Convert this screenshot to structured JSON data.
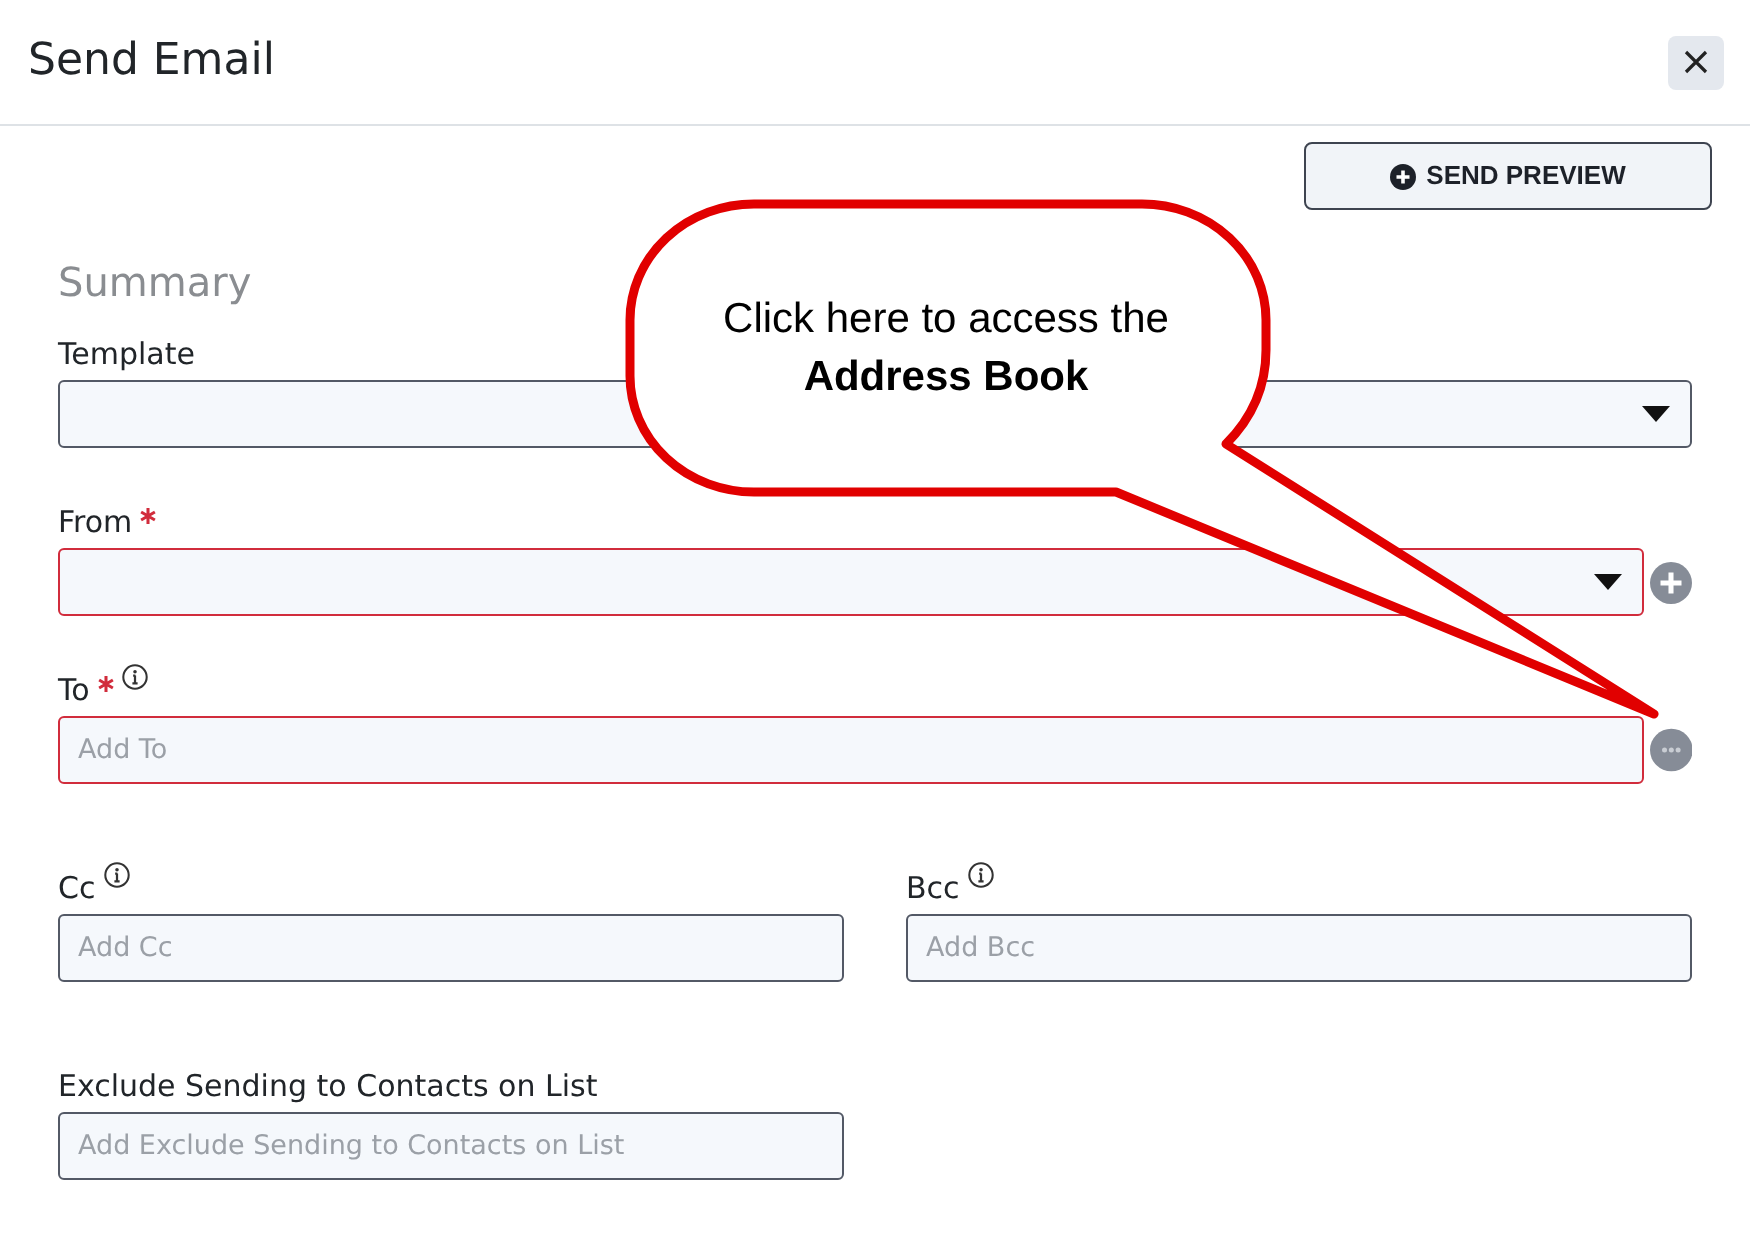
{
  "dialog": {
    "title": "Send Email"
  },
  "toolbar": {
    "send_preview": "SEND PREVIEW"
  },
  "section": {
    "title": "Summary"
  },
  "fields": [
    {
      "label": "Template",
      "kind": "select",
      "required": false,
      "invalid": false,
      "info": false
    },
    {
      "label": "From",
      "kind": "select",
      "required": true,
      "invalid": true,
      "info": false,
      "side_button": {
        "kind": "add"
      }
    },
    {
      "label": "To",
      "kind": "input",
      "placeholder": "Add To",
      "required": true,
      "invalid": true,
      "info": true,
      "side_button": {
        "kind": "more"
      }
    }
  ],
  "copy_fields": [
    {
      "label": "Cc",
      "kind": "input",
      "placeholder": "Add Cc",
      "required": false,
      "invalid": false,
      "info": true
    },
    {
      "label": "Bcc",
      "kind": "input",
      "placeholder": "Add Bcc",
      "required": false,
      "invalid": false,
      "info": true
    },
    {
      "label": "Exclude Sending to Contacts on List",
      "kind": "input",
      "placeholder": "Add Exclude Sending to Contacts on List",
      "required": false,
      "invalid": false,
      "info": false
    }
  ],
  "callout": {
    "text": "Click here to access the **Address Book**"
  }
}
